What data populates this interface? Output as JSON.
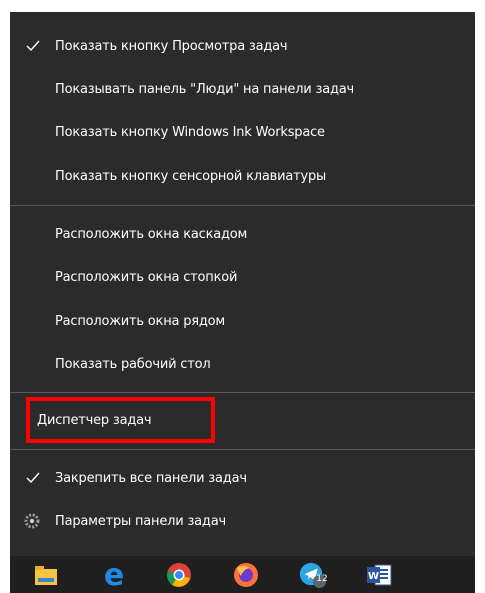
{
  "menu": {
    "group1": [
      {
        "label": "Показать кнопку Просмотра задач",
        "checked": true
      },
      {
        "label": "Показывать панель \"Люди\" на панели задач",
        "checked": false
      },
      {
        "label": "Показать кнопку Windows Ink Workspace",
        "checked": false
      },
      {
        "label": "Показать кнопку сенсорной клавиатуры",
        "checked": false
      }
    ],
    "group2": [
      {
        "label": "Расположить окна каскадом"
      },
      {
        "label": "Расположить окна стопкой"
      },
      {
        "label": "Расположить окна рядом"
      },
      {
        "label": "Показать рабочий стол"
      }
    ],
    "task_manager": {
      "label": "Диспетчер задач"
    },
    "group3": [
      {
        "label": "Закрепить все панели задач",
        "checked": true,
        "icon": "checkmark-icon"
      },
      {
        "label": "Параметры панели задач",
        "icon": "gear-icon"
      }
    ]
  },
  "taskbar": {
    "icons": [
      "file-explorer-icon",
      "edge-icon",
      "chrome-icon",
      "firefox-icon",
      "telegram-icon",
      "word-icon"
    ],
    "telegram_badge": "12"
  },
  "colors": {
    "menu_bg": "#2b2b2b",
    "highlight": "#ff0000",
    "taskbar_bg": "#1f1f1f"
  }
}
